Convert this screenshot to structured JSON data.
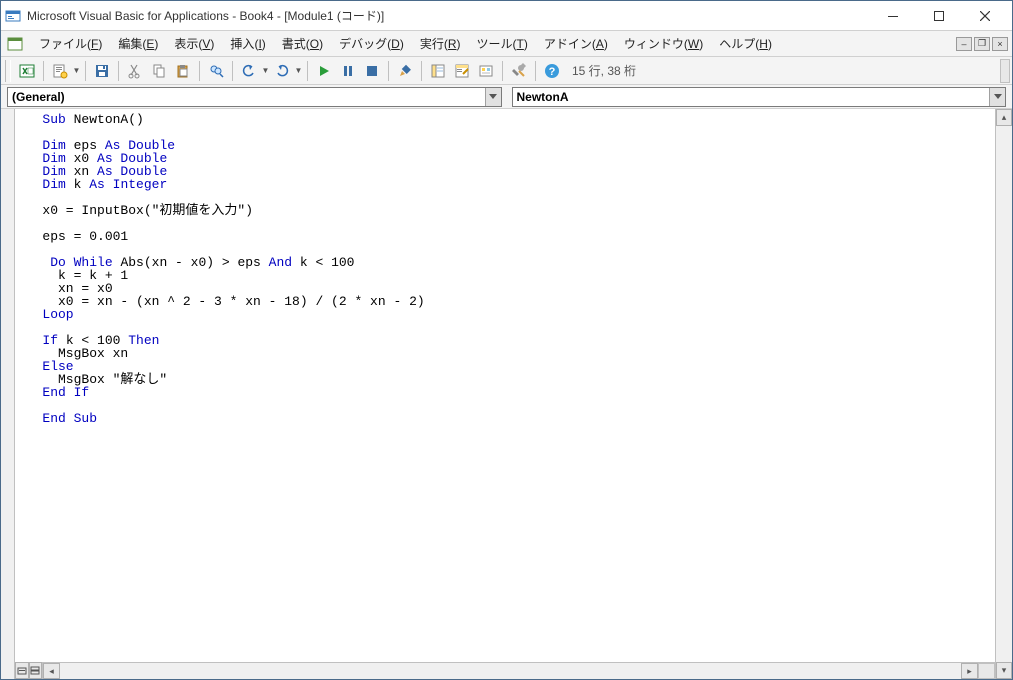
{
  "title": "Microsoft Visual Basic for Applications - Book4 - [Module1 (コード)]",
  "menus": {
    "file": {
      "label": "ファイル",
      "key": "F"
    },
    "edit": {
      "label": "編集",
      "key": "E"
    },
    "view": {
      "label": "表示",
      "key": "V"
    },
    "insert": {
      "label": "挿入",
      "key": "I"
    },
    "format": {
      "label": "書式",
      "key": "O"
    },
    "debug": {
      "label": "デバッグ",
      "key": "D"
    },
    "run": {
      "label": "実行",
      "key": "R"
    },
    "tools": {
      "label": "ツール",
      "key": "T"
    },
    "addins": {
      "label": "アドイン",
      "key": "A"
    },
    "window": {
      "label": "ウィンドウ",
      "key": "W"
    },
    "help": {
      "label": "ヘルプ",
      "key": "H"
    }
  },
  "toolbar_status": "15 行, 38 桁",
  "combo": {
    "left": "(General)",
    "right": "NewtonA"
  },
  "code_tokens": [
    [
      {
        "t": "Sub ",
        "c": "kw"
      },
      {
        "t": "NewtonA()"
      }
    ],
    [],
    [
      {
        "t": "Dim ",
        "c": "kw"
      },
      {
        "t": "eps "
      },
      {
        "t": "As Double",
        "c": "kw"
      }
    ],
    [
      {
        "t": "Dim ",
        "c": "kw"
      },
      {
        "t": "x0 "
      },
      {
        "t": "As Double",
        "c": "kw"
      }
    ],
    [
      {
        "t": "Dim ",
        "c": "kw"
      },
      {
        "t": "xn "
      },
      {
        "t": "As Double",
        "c": "kw"
      }
    ],
    [
      {
        "t": "Dim ",
        "c": "kw"
      },
      {
        "t": "k "
      },
      {
        "t": "As Integer",
        "c": "kw"
      }
    ],
    [],
    [
      {
        "t": "x0 = InputBox(\"初期値を入力\")"
      }
    ],
    [],
    [
      {
        "t": "eps = 0.001"
      }
    ],
    [],
    [
      {
        "t": " "
      },
      {
        "t": "Do While ",
        "c": "kw"
      },
      {
        "t": "Abs(xn - x0) > eps "
      },
      {
        "t": "And",
        "c": "kw"
      },
      {
        "t": " k < 100"
      }
    ],
    [
      {
        "t": "  k = k + 1"
      }
    ],
    [
      {
        "t": "  xn = x0"
      }
    ],
    [
      {
        "t": "  x0 = xn - (xn ^ 2 - 3 * xn - 18"
      },
      {
        "t": "|",
        "c": "cursor"
      },
      {
        "t": ") / (2 * xn - 2)"
      }
    ],
    [
      {
        "t": "Loop",
        "c": "kw"
      }
    ],
    [],
    [
      {
        "t": "If ",
        "c": "kw"
      },
      {
        "t": "k < 100 "
      },
      {
        "t": "Then",
        "c": "kw"
      }
    ],
    [
      {
        "t": "  MsgBox xn"
      }
    ],
    [
      {
        "t": "Else",
        "c": "kw"
      }
    ],
    [
      {
        "t": "  MsgBox \"解なし\""
      }
    ],
    [
      {
        "t": "End If",
        "c": "kw"
      }
    ],
    [],
    [
      {
        "t": "End Sub",
        "c": "kw"
      }
    ]
  ],
  "indent": "   "
}
